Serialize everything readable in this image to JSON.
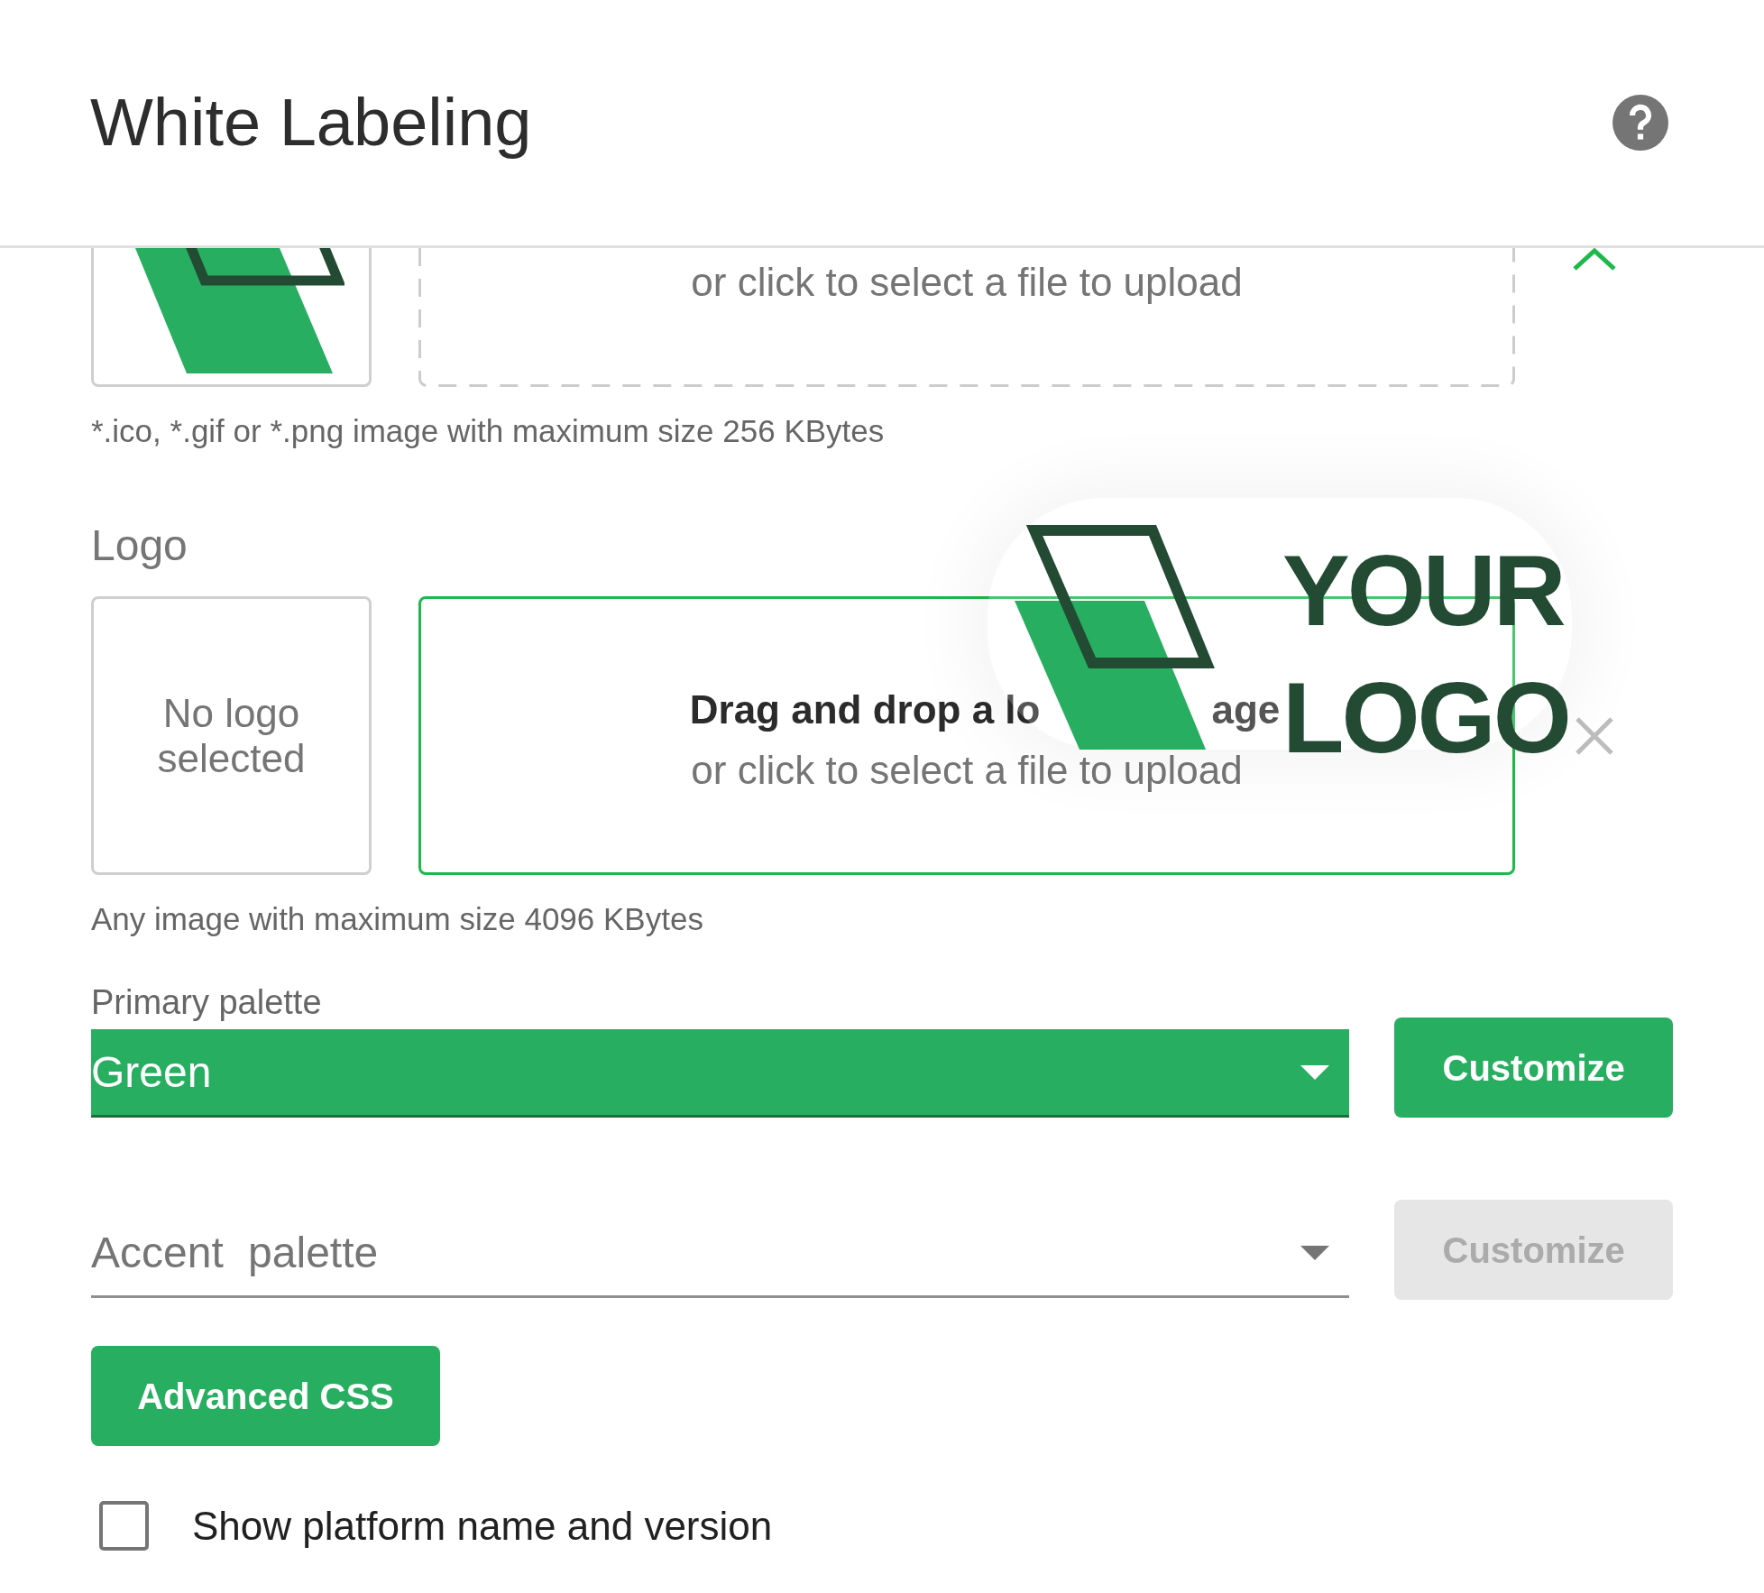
{
  "header": {
    "title": "White Labeling"
  },
  "favicon": {
    "upload_hint": "or click to select a file to upload",
    "note": "*.ico, *.gif or *.png image with maximum size 256 KBytes",
    "drag_over": false,
    "expanded": true
  },
  "logo": {
    "label": "Logo",
    "preview_text": "No logo selected",
    "drop_title_parts": [
      "Drag and drop a lo",
      "age"
    ],
    "upload_hint": "or click to select a file to upload",
    "note": "Any image with maximum size 4096 KBytes",
    "drag_over": true
  },
  "dragged_logo": {
    "wordmark": "YOUR LOGO"
  },
  "primary_palette": {
    "label": "Primary palette",
    "value": "Green",
    "customize": {
      "label": "Customize",
      "disabled": false
    }
  },
  "accent_palette": {
    "placeholder": "Accent palette",
    "customize": {
      "label": "Customize",
      "disabled": true
    }
  },
  "advanced_css": {
    "label": "Advanced CSS"
  },
  "show_version": {
    "label": "Show platform name and version",
    "checked": false
  }
}
